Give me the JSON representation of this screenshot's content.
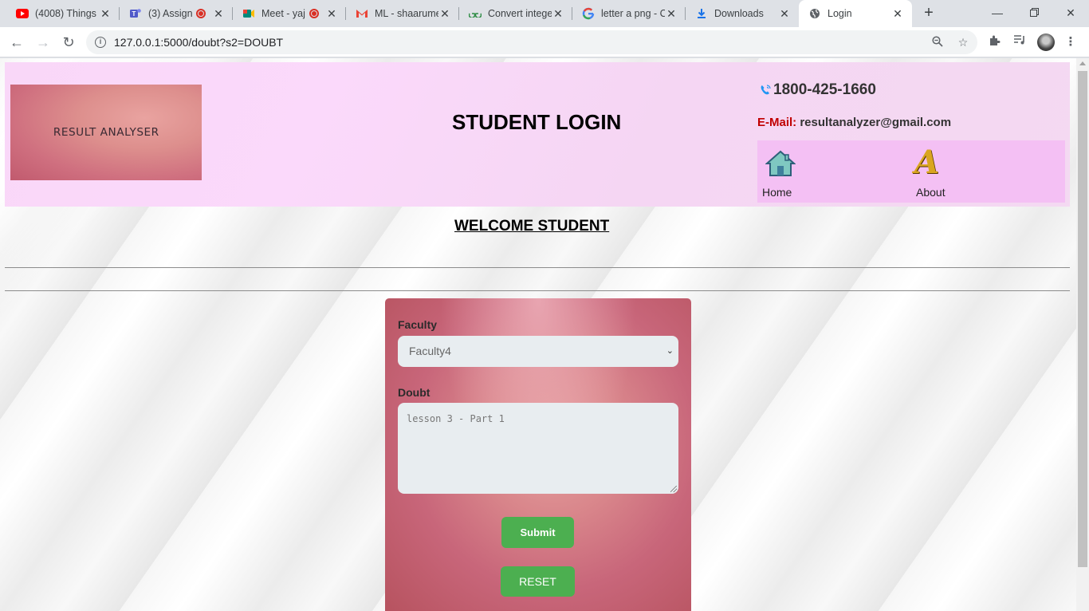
{
  "browser": {
    "tabs": [
      {
        "title": "(4008) Things",
        "icon": "youtube-icon"
      },
      {
        "title": "(3) Assign",
        "icon": "teams-icon"
      },
      {
        "title": "Meet - yaj",
        "icon": "meet-icon"
      },
      {
        "title": "ML - shaarume",
        "icon": "gmail-icon"
      },
      {
        "title": "Convert intege",
        "icon": "geeksforgeeks-icon"
      },
      {
        "title": "letter a png - C",
        "icon": "google-icon"
      },
      {
        "title": "Downloads",
        "icon": "download-icon"
      },
      {
        "title": "Login",
        "icon": "globe-icon"
      }
    ],
    "url": "127.0.0.1:5000/doubt?s2=DOUBT"
  },
  "header": {
    "logo_text": "RESULT ANALYSER",
    "title": "STUDENT LOGIN",
    "phone": "1800-425-1660",
    "email_label": "E-Mail:",
    "email": "resultanalyzer@gmail.com",
    "nav": {
      "home": "Home",
      "about": "About"
    }
  },
  "main": {
    "welcome": "WELCOME STUDENT",
    "form": {
      "faculty_label": "Faculty",
      "faculty_value": "Faculty4",
      "doubt_label": "Doubt",
      "doubt_value": "lesson 3 - Part 1",
      "submit_label": "Submit",
      "reset_label": "RESET"
    }
  },
  "colors": {
    "accent_green": "#4caf50",
    "email_label_red": "#c00000",
    "nav_box_pink": "#f4c0f4"
  }
}
